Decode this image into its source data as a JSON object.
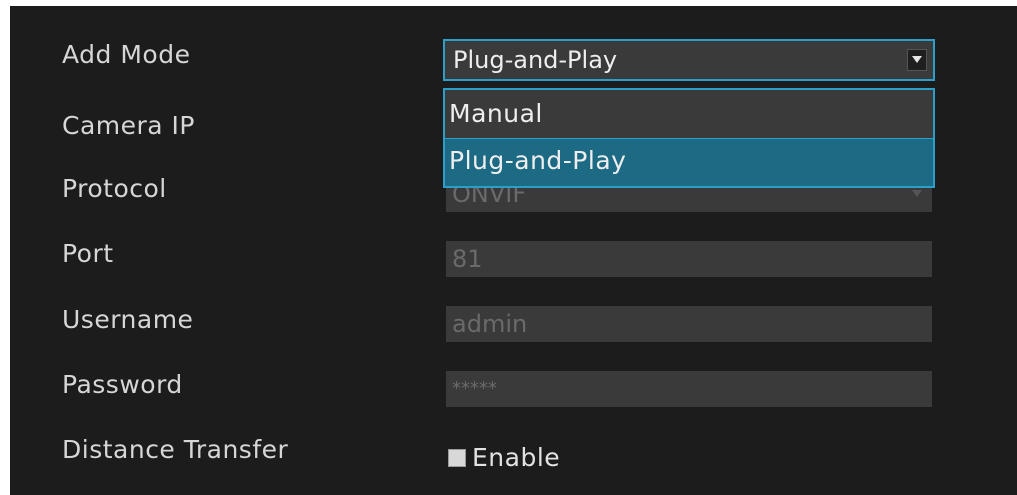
{
  "form": {
    "add_mode": {
      "label": "Add Mode",
      "selected": "Plug-and-Play",
      "options": [
        "Manual",
        "Plug-and-Play"
      ]
    },
    "camera_ip": {
      "label": "Camera IP"
    },
    "protocol": {
      "label": "Protocol",
      "value": "ONVIF"
    },
    "port": {
      "label": "Port",
      "value": "81"
    },
    "username": {
      "label": "Username",
      "value": "admin"
    },
    "password": {
      "label": "Password",
      "value": "*****"
    },
    "distance_transfer": {
      "label": "Distance Transfer",
      "checkbox_label": "Enable"
    }
  },
  "icons": {
    "dropdown": "chevron-down-icon",
    "checkbox": "checkbox-icon"
  },
  "colors": {
    "panel_bg": "#1c1c1c",
    "field_bg": "#3a3a3a",
    "accent": "#2b9fc9",
    "selected_option": "#1d6a84",
    "label_text": "#d6d6d6"
  }
}
